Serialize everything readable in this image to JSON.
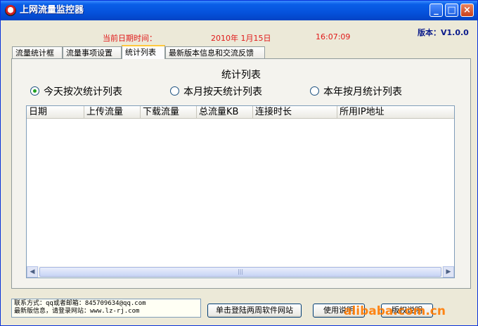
{
  "window": {
    "title": "上网流量监控器"
  },
  "header": {
    "date_label": "当前日期时间：",
    "date_value": "2010年 1月15日",
    "time_value": "16:07:09",
    "version": "版本：V1.0.0"
  },
  "tabs": [
    {
      "label": "流量统计框",
      "active": false
    },
    {
      "label": "流量事项设置",
      "active": false
    },
    {
      "label": "统计列表",
      "active": true
    },
    {
      "label": "最新版本信息和交流反馈",
      "active": false
    }
  ],
  "panel": {
    "title": "统计列表",
    "radios": [
      {
        "label": "今天按次统计列表",
        "checked": true
      },
      {
        "label": "本月按天统计列表",
        "checked": false
      },
      {
        "label": "本年按月统计列表",
        "checked": false
      }
    ],
    "columns": [
      "日期",
      "上传流量",
      "下载流量",
      "总流量KB",
      "连接时长",
      "所用IP地址"
    ],
    "rows": []
  },
  "footer": {
    "contact_line1": "联系方式：qq或者邮箱：845709634@qq.com",
    "contact_line2": "最新版信息，请登录网站：www.lz-rj.com",
    "buttons": {
      "visit": "单击登陆两周软件网站",
      "help": "使用说明",
      "copyright": "版权说明"
    }
  },
  "watermark": "alibaba.com.cn",
  "colors": {
    "title_bar": "#0552dc",
    "date_text": "#e01818",
    "version_text": "#0a1a8a",
    "tab_highlight": "#ffc83c"
  }
}
